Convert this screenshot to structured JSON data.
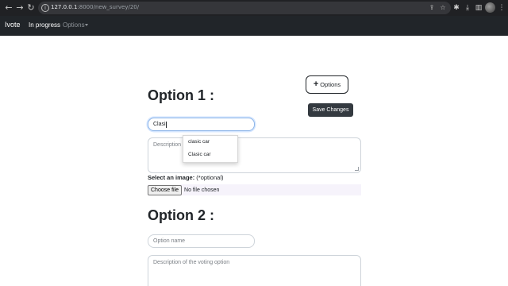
{
  "browser": {
    "url_host": "127.0.0.1",
    "url_path": ":8000/new_survey/20/",
    "back_icon": "←",
    "forward_icon": "→",
    "reload_icon": "↻"
  },
  "navbar": {
    "brand": "Ivote",
    "items": [
      {
        "label": "In progress",
        "active": true
      },
      {
        "label": "Options",
        "dropdown": true
      }
    ]
  },
  "toolbar": {
    "options_label": "Options",
    "save_label": "Save Changes"
  },
  "options": [
    {
      "heading": "Option 1 :",
      "name_value": "Clasi",
      "description_placeholder": "Description",
      "image_label": "Select an image:",
      "image_note": "(*optional)",
      "choose_file_label": "Choose file",
      "file_status": "No file chosen"
    },
    {
      "heading": "Option 2 :",
      "name_placeholder": "Option name",
      "description_placeholder": "Description of the voting option"
    }
  ],
  "autocomplete": {
    "items": [
      "clasic car",
      "Clasic car"
    ]
  },
  "colors": {
    "navbar_bg": "#212529",
    "save_button_bg": "#343a40",
    "focus_border": "#8fb6e8"
  }
}
